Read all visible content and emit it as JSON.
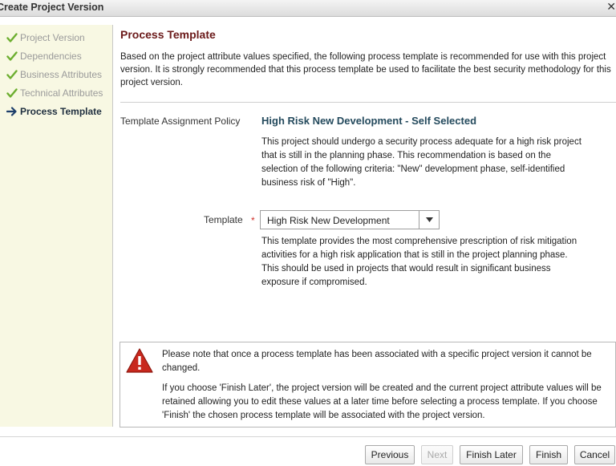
{
  "window": {
    "title": "Create Project Version",
    "close_glyph": "✕"
  },
  "steps": [
    {
      "label": "Project Version",
      "icon": "check-icon",
      "state": "done"
    },
    {
      "label": "Dependencies",
      "icon": "check-icon",
      "state": "done"
    },
    {
      "label": "Business Attributes",
      "icon": "check-icon",
      "state": "done"
    },
    {
      "label": "Technical Attributes",
      "icon": "check-icon",
      "state": "done"
    },
    {
      "label": "Process Template",
      "icon": "arrow-right-icon",
      "state": "current"
    }
  ],
  "main": {
    "heading": "Process Template",
    "intro": "Based on the project attribute values specified, the following process template is recommended for use with this project version. It is strongly recommended that this process template be used to facilitate the best security methodology for this project version.",
    "policy_label": "Template Assignment Policy",
    "policy_value": "High Risk New Development - Self Selected",
    "policy_description": "This project should undergo a security process adequate for a high risk project that is still in the planning phase. This recommendation is based on the selection of the following criteria: \"New\" development phase, self-identified business risk of \"High\".",
    "template_label": "Template",
    "required_marker": "*",
    "template_selected": "High Risk New Development",
    "template_description": "This template provides the most comprehensive prescription of risk mitigation activities for a high risk application that is still in the project planning phase. This should be used in projects that would result in significant business exposure if compromised."
  },
  "notice": {
    "icon": "warning-icon",
    "text1": "Please note that once a process template has been associated with a specific project version it cannot be changed.",
    "text2": "If you choose 'Finish Later', the project version will be created and the current project attribute values will be retained allowing you to edit these values at a later time before selecting a process template.  If you choose 'Finish' the chosen process template will be associated with the project version."
  },
  "footer": {
    "previous": "Previous",
    "next": "Next",
    "finish_later": "Finish Later",
    "finish": "Finish",
    "cancel": "Cancel"
  },
  "colors": {
    "sidebar_bg": "#f8f8e3",
    "heading": "#6b1a1a",
    "policy_value": "#244a5d",
    "check_green": "#6cae2f",
    "warning_red": "#c8281e"
  }
}
